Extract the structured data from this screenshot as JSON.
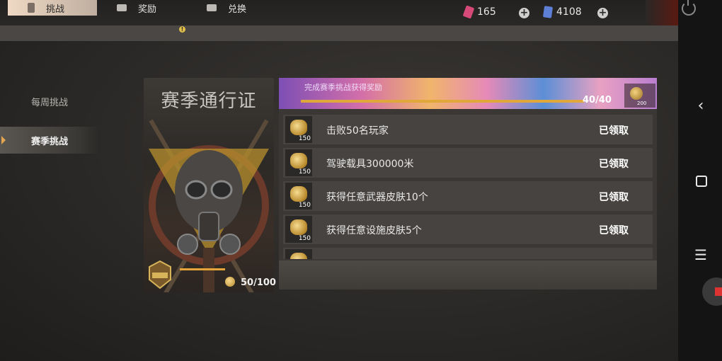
{
  "currencies": [
    {
      "icon": "red-ticket-icon",
      "value": "165",
      "color": "#d64a7a"
    },
    {
      "icon": "blue-card-icon",
      "value": "4108",
      "color": "#5e7fd6"
    }
  ],
  "tabs": [
    {
      "label": "挑战",
      "icon": "challenge-tab-icon",
      "active": true
    },
    {
      "label": "奖励",
      "icon": "reward-tab-icon",
      "active": false,
      "badge": "!"
    },
    {
      "label": "兑换",
      "icon": "exchange-tab-icon",
      "active": false
    }
  ],
  "menu": [
    {
      "label": "每周挑战",
      "active": false
    },
    {
      "label": "赛季挑战",
      "active": true
    }
  ],
  "pass": {
    "title": "赛季通行证",
    "points": "50/100"
  },
  "banner": {
    "text": "完成赛季挑战获得奖励",
    "count": "40/40",
    "reward_points": "200",
    "progress": 1.0
  },
  "challenges": [
    {
      "label": "击败50名玩家",
      "points": "150",
      "status": "已领取"
    },
    {
      "label": "驾驶载具300000米",
      "points": "150",
      "status": "已领取"
    },
    {
      "label": "获得任意武器皮肤10个",
      "points": "150",
      "status": "已领取"
    },
    {
      "label": "获得任意设施皮肤5个",
      "points": "150",
      "status": "已领取"
    }
  ],
  "nav": {
    "back": "‹",
    "menu": "☰"
  }
}
